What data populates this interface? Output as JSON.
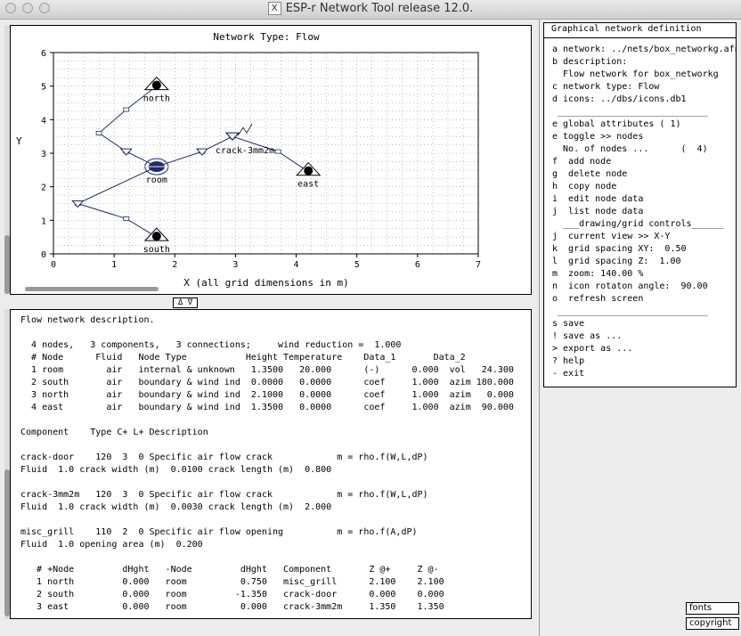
{
  "window": {
    "title": "ESP-r Network Tool release 12.0."
  },
  "chart_data": {
    "type": "diagram",
    "title": "Network Type: Flow",
    "xlabel": "X (all grid dimensions in m)",
    "ylabel": "Y",
    "xlim": [
      0,
      7
    ],
    "ylim": [
      0,
      6
    ],
    "xticks": [
      "0",
      "1",
      "2",
      "3",
      "4",
      "5",
      "6",
      "7"
    ],
    "yticks": [
      "0",
      "1",
      "2",
      "3",
      "4",
      "5",
      "6"
    ],
    "grid": true,
    "nodes": [
      {
        "name": "north",
        "x": 1.7,
        "y": 5.0,
        "kind": "boundary"
      },
      {
        "name": "room",
        "x": 1.7,
        "y": 2.6,
        "kind": "internal"
      },
      {
        "name": "east",
        "x": 4.2,
        "y": 2.45,
        "kind": "boundary"
      },
      {
        "name": "south",
        "x": 1.7,
        "y": 0.5,
        "kind": "boundary"
      }
    ],
    "components": [
      {
        "name": "crack-3mm2m",
        "x": 2.95,
        "y": 3.5
      }
    ],
    "connections": [
      {
        "points": [
          [
            1.7,
            2.6
          ],
          [
            0.4,
            1.5
          ],
          [
            1.2,
            1.05
          ],
          [
            1.7,
            0.5
          ]
        ]
      },
      {
        "points": [
          [
            1.7,
            2.6
          ],
          [
            1.2,
            3.05
          ],
          [
            0.75,
            3.6
          ],
          [
            1.2,
            4.3
          ],
          [
            1.7,
            5.0
          ]
        ]
      },
      {
        "points": [
          [
            1.7,
            2.6
          ],
          [
            2.45,
            3.05
          ],
          [
            2.95,
            3.5
          ],
          [
            3.7,
            3.05
          ],
          [
            4.2,
            2.45
          ]
        ]
      }
    ]
  },
  "description": {
    "lines": [
      "Flow network description.",
      "",
      "  4 nodes,   3 components,   3 connections;     wind reduction =  1.000",
      "  # Node      Fluid   Node Type           Height Temperature    Data_1       Data_2",
      "  1 room        air   internal & unknown   1.3500   20.000      (-)      0.000  vol   24.300",
      "  2 south       air   boundary & wind ind  0.0000   0.0000      coef     1.000  azim 180.000",
      "  3 north       air   boundary & wind ind  2.1000   0.0000      coef     1.000  azim   0.000",
      "  4 east        air   boundary & wind ind  1.3500   0.0000      coef     1.000  azim  90.000",
      "",
      "Component    Type C+ L+ Description",
      "",
      "crack-door    120  3  0 Specific air flow crack            m = rho.f(W,L,dP)",
      "Fluid  1.0 crack width (m)  0.0100 crack length (m)  0.800",
      "",
      "crack-3mm2m   120  3  0 Specific air flow crack            m = rho.f(W,L,dP)",
      "Fluid  1.0 crack width (m)  0.0030 crack length (m)  2.000",
      "",
      "misc_grill    110  2  0 Specific air flow opening          m = rho.f(A,dP)",
      "Fluid  1.0 opening area (m)  0.200",
      "",
      "   # +Node         dHght   -Node         dHght   Component       Z @+     Z @-",
      "   1 north         0.000   room          0.750   misc_grill      2.100    2.100",
      "   2 south         0.000   room         -1.350   crack-door      0.000    0.000",
      "   3 east          0.000   room          0.000   crack-3mm2m     1.350    1.350"
    ]
  },
  "menu": {
    "title": "Graphical network definition",
    "items": [
      "a network: ../nets/box_networkg.afn",
      "b description:",
      "  Flow network for box_networkg",
      "c network type: Flow",
      "d icons: ../dbs/icons.db1",
      " ____________________________",
      "e global attributes ( 1)",
      "e toggle >> nodes",
      "  No. of nodes ...      (  4)",
      "f  add node",
      "g  delete node",
      "h  copy node",
      "i  edit node data",
      "j  list node data",
      "  ___drawing/grid controls______",
      "j  current view >> X-Y",
      "k  grid spacing XY:  0.50",
      "l  grid spacing Z:  1.00",
      "m  zoom: 140.00 %",
      "n  icon rotaton angle:  90.00",
      "o  refresh screen",
      " ____________________________",
      "s save",
      "! save as ...",
      "> export as ...",
      "? help",
      "- exit"
    ]
  },
  "buttons": {
    "divider": "Δ ∇",
    "fonts": "fonts",
    "copyright": "copyright"
  }
}
